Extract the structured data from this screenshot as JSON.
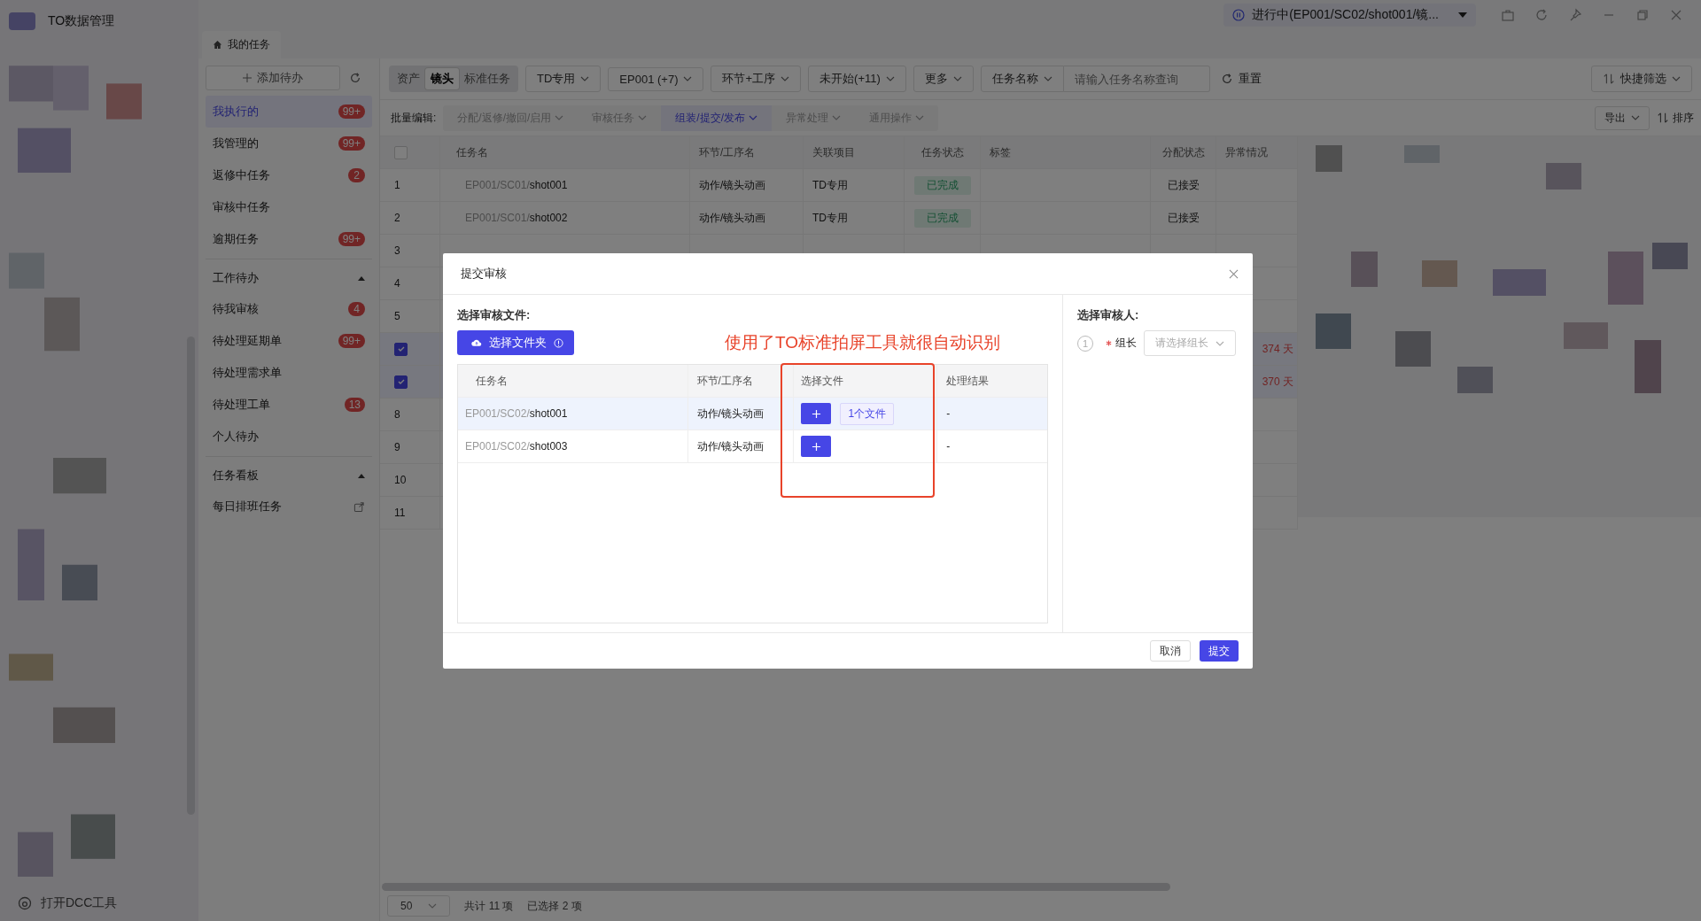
{
  "app": {
    "title": "TO数据管理",
    "dcc_tool": "打开DCC工具"
  },
  "title_bar": {
    "status": "进行中(EP001/SC02/shot001/镜..."
  },
  "page_tab": {
    "label": "我的任务"
  },
  "sidebar": {
    "add_button": "添加待办",
    "items": [
      {
        "label": "我执行的",
        "badge": "99+",
        "selected": true
      },
      {
        "label": "我管理的",
        "badge": "99+",
        "selected": false
      },
      {
        "label": "返修中任务",
        "badge": "2",
        "selected": false
      },
      {
        "label": "审核中任务",
        "selected": false
      },
      {
        "label": "逾期任务",
        "badge": "99+",
        "selected": false
      }
    ],
    "sections": [
      {
        "title": "工作待办",
        "expanded": true,
        "items": [
          {
            "label": "待我审核",
            "badge": "4",
            "kind": "plain"
          },
          {
            "label": "待处理延期单",
            "badge": "99+",
            "kind": "plain"
          },
          {
            "label": "待处理需求单",
            "kind": "plain"
          },
          {
            "label": "待处理工单",
            "badge": "13",
            "kind": "plain"
          },
          {
            "label": "个人待办",
            "kind": "plain"
          }
        ]
      },
      {
        "title": "任务看板",
        "expanded": true,
        "items": [
          {
            "label": "每日排班任务",
            "kind": "external"
          }
        ]
      }
    ]
  },
  "toolbar": {
    "segments": [
      {
        "label": "资产",
        "selected": false
      },
      {
        "label": "镜头",
        "selected": true
      },
      {
        "label": "标准任务",
        "selected": false
      }
    ],
    "filters": [
      "TD专用",
      "EP001 (+7)",
      "环节+工序",
      "未开始(+11)",
      "更多"
    ],
    "search": {
      "field": "任务名称",
      "placeholder": "请输入任务名称查询"
    },
    "reset": "重置",
    "quick_filter": "快捷筛选"
  },
  "batch_bar": {
    "label": "批量编辑:",
    "menus": [
      {
        "label": "分配/返修/撤回/启用",
        "selected": false
      },
      {
        "label": "审核任务",
        "selected": false
      },
      {
        "label": "组装/提交/发布",
        "selected": true
      },
      {
        "label": "异常处理",
        "selected": false
      },
      {
        "label": "通用操作",
        "selected": false
      }
    ],
    "export": "导出",
    "sort": "排序"
  },
  "table": {
    "select_all": false,
    "columns": [
      "任务名",
      "环节/工序名",
      "关联项目",
      "任务状态",
      "标签",
      "分配状态",
      "异常情况"
    ],
    "rows": [
      {
        "index": "1",
        "checked": false,
        "prefix": "EP001/SC01/",
        "name": "shot001",
        "stage": "动作/镜头动画",
        "project": "TD专用",
        "status": "已完成",
        "assign": "已接受"
      },
      {
        "index": "2",
        "checked": false,
        "prefix": "EP001/SC01/",
        "name": "shot002",
        "stage": "动作/镜头动画",
        "project": "TD专用",
        "status": "已完成",
        "assign": "已接受"
      },
      {
        "index": "3",
        "checked": false
      },
      {
        "index": "4",
        "checked": false
      },
      {
        "index": "5",
        "checked": false
      },
      {
        "checked": true,
        "exception": "374 天"
      },
      {
        "checked": true,
        "exception": "370 天"
      },
      {
        "index": "8",
        "checked": false
      },
      {
        "index": "9",
        "checked": false
      },
      {
        "index": "10",
        "checked": false
      },
      {
        "index": "11",
        "checked": false
      }
    ]
  },
  "footer": {
    "page_size": "50",
    "total": "共计 11 项",
    "selected": "已选择 2 项"
  },
  "dialog": {
    "title": "提交审核",
    "files_label": "选择审核文件:",
    "folder_button": "选择文件夹",
    "annotation": "使用了TO标准拍屏工具就很自动识别",
    "columns": [
      "任务名",
      "环节/工序名",
      "选择文件",
      "处理结果"
    ],
    "rows": [
      {
        "prefix": "EP001/SC02/",
        "name": "shot001",
        "stage": "动作/镜头动画",
        "files": "1个文件",
        "result": "-",
        "selected": true
      },
      {
        "prefix": "EP001/SC02/",
        "name": "shot003",
        "stage": "动作/镜头动画",
        "result": "-",
        "selected": false
      }
    ],
    "reviewer_label": "选择审核人:",
    "step": "1",
    "field_label": "组长",
    "required": true,
    "placeholder": "请选择组长",
    "buttons": [
      {
        "label": "取消",
        "kind": "secondary"
      },
      {
        "label": "提交",
        "kind": "primary"
      }
    ]
  }
}
